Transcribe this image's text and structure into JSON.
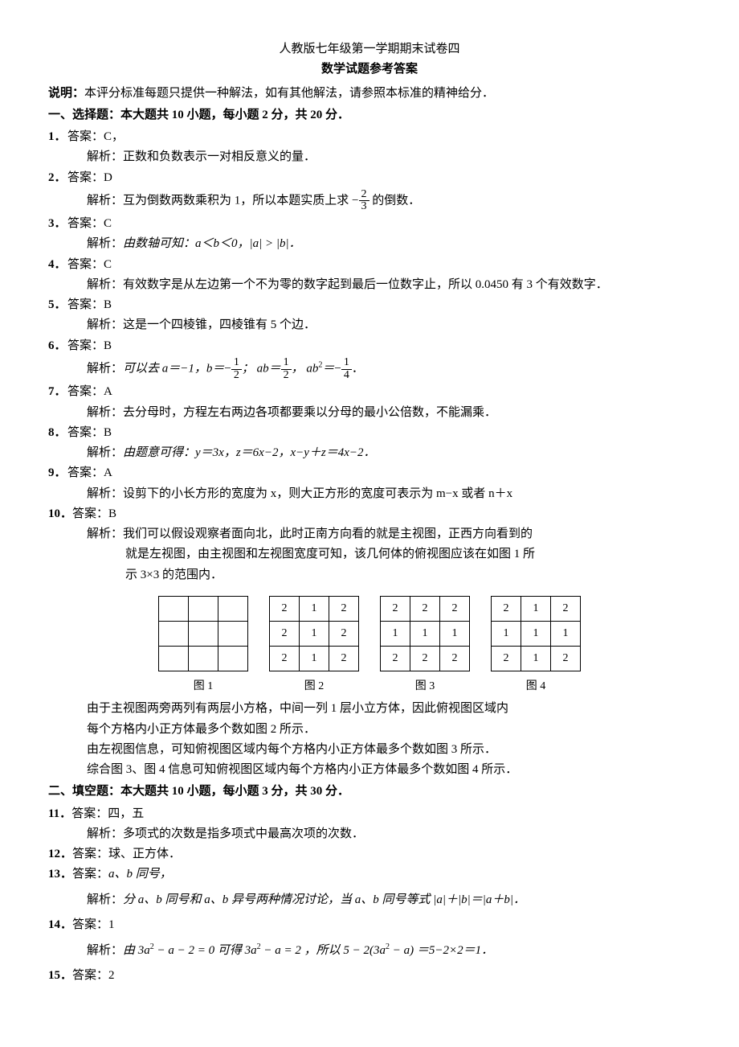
{
  "title": "人教版七年级第一学期期末试卷四",
  "subtitle": "数学试题参考答案",
  "note_label": "说明：",
  "note_text": "本评分标准每题只提供一种解法，如有其他解法，请参照本标准的精神给分．",
  "section1": "一、选择题：本大题共 10 小题，每小题 2 分，共 20 分．",
  "q1": {
    "num": "1．",
    "ans_label": "答案：",
    "ans": "C，",
    "exp_label": "解析：",
    "exp": "正数和负数表示一对相反意义的量．"
  },
  "q2": {
    "num": "2．",
    "ans_label": "答案：",
    "ans": "D",
    "exp_label": "解析：",
    "exp_a": "互为倒数两数乘积为 1，所以本题实质上求",
    "exp_b": "的倒数．",
    "frac_neg": "−",
    "frac_n": "2",
    "frac_d": "3"
  },
  "q3": {
    "num": "3．",
    "ans_label": "答案：",
    "ans": "C",
    "exp_label": "解析：",
    "exp": "由数轴可知：a＜b＜0，|a| > |b|．"
  },
  "q4": {
    "num": "4．",
    "ans_label": "答案：",
    "ans": "C",
    "exp_label": "解析：",
    "exp": "有效数字是从左边第一个不为零的数字起到最后一位数字止，所以 0.0450 有 3  个有效数字．"
  },
  "q5": {
    "num": "5．",
    "ans_label": "答案：",
    "ans": "B",
    "exp_label": "解析：",
    "exp": "这是一个四棱锥，四棱锥有 5 个边．"
  },
  "q6": {
    "num": "6．",
    "ans_label": "答案：",
    "ans": "B",
    "exp_label": "解析：",
    "t1": "可以去 a＝−1，b＝",
    "neg1": "−",
    "f1n": "1",
    "f1d": "2",
    "t2": "；  ab＝",
    "f2n": "1",
    "f2d": "2",
    "t3": "，  ab",
    "sq": "2",
    "t4": "＝",
    "neg2": "−",
    "f3n": "1",
    "f3d": "4",
    "t5": "．"
  },
  "q7": {
    "num": "7．",
    "ans_label": "答案：",
    "ans": "A",
    "exp_label": "解析：",
    "exp": "去分母时，方程左右两边各项都要乘以分母的最小公倍数，不能漏乘．"
  },
  "q8": {
    "num": "8．",
    "ans_label": "答案：",
    "ans": "B",
    "exp_label": "解析：",
    "exp": "由题意可得：y＝3x，z＝6x−2，x−y＋z＝4x−2．"
  },
  "q9": {
    "num": "9．",
    "ans_label": "答案：",
    "ans": "A",
    "exp_label": "解析：",
    "exp": "设剪下的小长方形的宽度为 x，则大正方形的宽度可表示为 m−x 或者 n＋x"
  },
  "q10": {
    "num": "10．",
    "ans_label": "答案：",
    "ans": "B",
    "exp_label": "解析：",
    "l1": "我们可以假设观察者面向北，此时正南方向看的就是主视图，正西方向看到的",
    "l2": "就是左视图，由主视图和左视图宽度可知，该几何体的俯视图应该在如图 1 所",
    "l3": "示 3×3 的范围内．",
    "p1": "由于主视图两旁两列有两层小方格，中间一列 1 层小立方体，因此俯视图区域内",
    "p2": "每个方格内小正方体最多个数如图 2 所示．",
    "p3": "由左视图信息，可知俯视图区域内每个方格内小正方体最多个数如图 3 所示．",
    "p4": "综合图 3、图 4 信息可知俯视图区域内每个方格内小正方体最多个数如图 4 所示．"
  },
  "tables": {
    "t1": {
      "cap": "图 1",
      "rows": [
        [
          "",
          "",
          ""
        ],
        [
          "",
          "",
          ""
        ],
        [
          "",
          "",
          ""
        ]
      ]
    },
    "t2": {
      "cap": "图 2",
      "rows": [
        [
          "2",
          "1",
          "2"
        ],
        [
          "2",
          "1",
          "2"
        ],
        [
          "2",
          "1",
          "2"
        ]
      ]
    },
    "t3": {
      "cap": "图 3",
      "rows": [
        [
          "2",
          "2",
          "2"
        ],
        [
          "1",
          "1",
          "1"
        ],
        [
          "2",
          "2",
          "2"
        ]
      ]
    },
    "t4": {
      "cap": "图 4",
      "rows": [
        [
          "2",
          "1",
          "2"
        ],
        [
          "1",
          "1",
          "1"
        ],
        [
          "2",
          "1",
          "2"
        ]
      ]
    }
  },
  "section2": "二、填空题：本大题共 10 小题，每小题 3 分，共 30 分．",
  "q11": {
    "num": "11．",
    "ans_label": "答案：",
    "ans": "四，五",
    "exp_label": "解析：",
    "exp": "多项式的次数是指多项式中最高次项的次数．"
  },
  "q12": {
    "num": "12．",
    "ans_label": "答案：",
    "ans": "球、正方体．"
  },
  "q13": {
    "num": "13．",
    "ans_label": "答案：",
    "ans": "a、b 同号，",
    "exp_label": "解析：",
    "exp": "分 a、b 同号和 a、b 异号两种情况讨论，当 a、b 同号等式 |a|＋|b|＝|a＋b|．"
  },
  "q14": {
    "num": "14．",
    "ans_label": "答案：",
    "ans": "1",
    "exp_label": "解析：",
    "t1": "由 3a",
    "s1": "2",
    "t2": " − a − 2 = 0 可得 3a",
    "s2": "2",
    "t3": " − a = 2 ，所以 5 − 2(3a",
    "s3": "2",
    "t4": " − a) ＝5−2×2＝1．"
  },
  "q15": {
    "num": "15．",
    "ans_label": "答案：",
    "ans": "2"
  }
}
